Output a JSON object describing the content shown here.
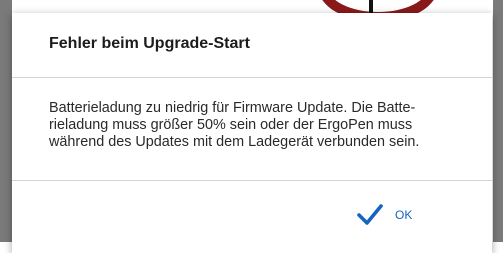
{
  "dialog": {
    "title": "Fehler beim Upgrade-Start",
    "message": "Batterieladung zu niedrig für Firmware Update. Die Batte-rieladung muss größer 50% sein oder der ErgoPen muss während des Updates mit dem Ladegerät verbunden sein.",
    "ok_label": "OK",
    "ok_icon": "checkmark-icon"
  },
  "colors": {
    "accent": "#1565c0",
    "title_text": "#1c1c1c",
    "body_text": "#2a2a2a",
    "divider": "#d4d4d4"
  }
}
